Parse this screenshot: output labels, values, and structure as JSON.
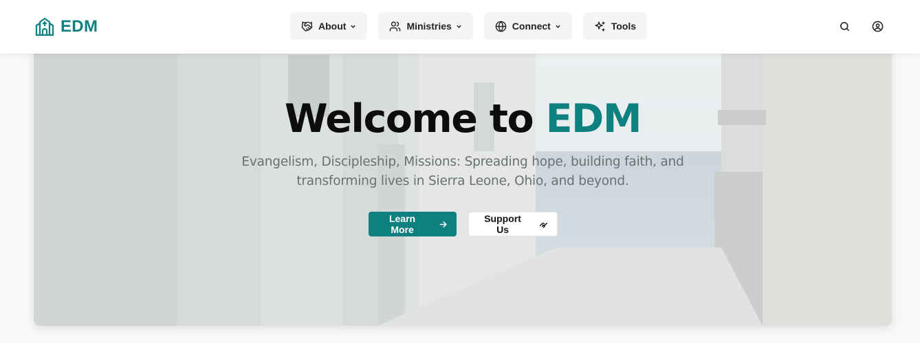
{
  "brand": {
    "name": "EDM",
    "icon": "church-icon",
    "color": "#0e8080"
  },
  "nav": {
    "items": [
      {
        "label": "About",
        "icon": "handshake-icon",
        "dropdown": true
      },
      {
        "label": "Ministries",
        "icon": "users-icon",
        "dropdown": true
      },
      {
        "label": "Connect",
        "icon": "globe-icon",
        "dropdown": true
      },
      {
        "label": "Tools",
        "icon": "sparkles-icon",
        "dropdown": false
      }
    ],
    "actions": [
      {
        "icon": "search-icon"
      },
      {
        "icon": "user-circle-icon"
      }
    ]
  },
  "hero": {
    "title_prefix": "Welcome to",
    "title_accent": "EDM",
    "subtitle": "Evangelism, Discipleship, Missions: Spreading hope, building faith, and transforming lives in Sierra Leone, Ohio, and beyond.",
    "primary_button": {
      "label": "Learn More",
      "icon": "arrow-right-icon"
    },
    "secondary_button": {
      "label": "Support Us",
      "icon": "handshake-icon"
    }
  },
  "colors": {
    "accent": "#0e8080",
    "navbar_bg": "#ffffff",
    "page_bg": "#f8f8f8"
  }
}
